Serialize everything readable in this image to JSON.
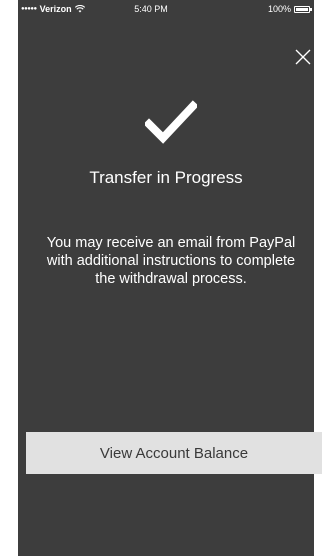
{
  "status_bar": {
    "carrier": "Verizon",
    "signal_dots": "●●●●●",
    "time": "5:40 PM",
    "battery": "100%"
  },
  "icons": {
    "close": "close-icon",
    "check": "checkmark-icon",
    "wifi": "wifi-icon",
    "battery": "battery-icon"
  },
  "main": {
    "title": "Transfer in Progress",
    "message": "You may receive an email from PayPal with additional instructions to complete the withdrawal process."
  },
  "actions": {
    "view_balance_label": "View Account Balance"
  },
  "colors": {
    "background": "#3d3d3d",
    "text": "#ffffff",
    "button_bg": "#e1e1e1",
    "button_text": "#3a3a3a"
  }
}
